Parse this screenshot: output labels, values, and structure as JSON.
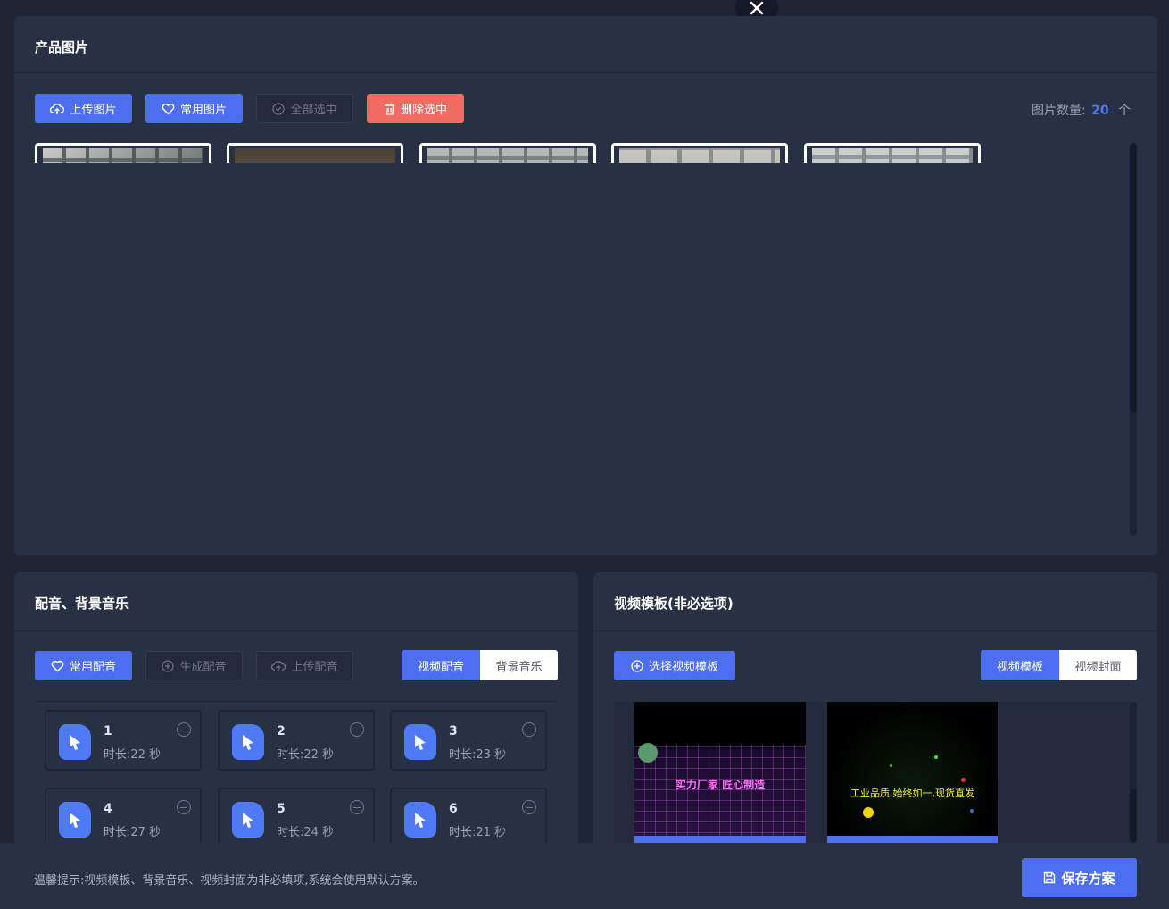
{
  "close_icon": "close-icon",
  "product_images": {
    "title": "产品图片",
    "toolbar": {
      "upload": "上传图片",
      "common": "常用图片",
      "select_all": "全部选中",
      "delete_selected": "删除选中"
    },
    "count_label": "图片数量:",
    "count_value": "20",
    "count_unit": "个"
  },
  "audio": {
    "title": "配音、背景音乐",
    "toolbar": {
      "common": "常用配音",
      "generate": "生成配音",
      "upload": "上传配音"
    },
    "tabs": [
      "视频配音",
      "背景音乐"
    ],
    "items": [
      {
        "name": "1",
        "duration": "时长:22 秒"
      },
      {
        "name": "2",
        "duration": "时长:22 秒"
      },
      {
        "name": "3",
        "duration": "时长:23 秒"
      },
      {
        "name": "4",
        "duration": "时长:27 秒"
      },
      {
        "name": "5",
        "duration": "时长:24 秒"
      },
      {
        "name": "6",
        "duration": "时长:21 秒"
      }
    ]
  },
  "video_template": {
    "title": "视频模板(非必选项)",
    "select_button": "选择视频模板",
    "tabs": [
      "视频模板",
      "视频封面"
    ],
    "templates": [
      {
        "text": "实力厂家 匠心制造"
      },
      {
        "text": "工业品质,始终如一,现货直发"
      }
    ]
  },
  "footer": {
    "tip": "温馨提示:视频模板、背景音乐、视频封面为非必填项,系统会使用默认方案。",
    "save": "保存方案"
  },
  "colors": {
    "primary": "#4e6ef2",
    "danger": "#f26b62",
    "panel": "#283044",
    "background": "#1f2535"
  }
}
